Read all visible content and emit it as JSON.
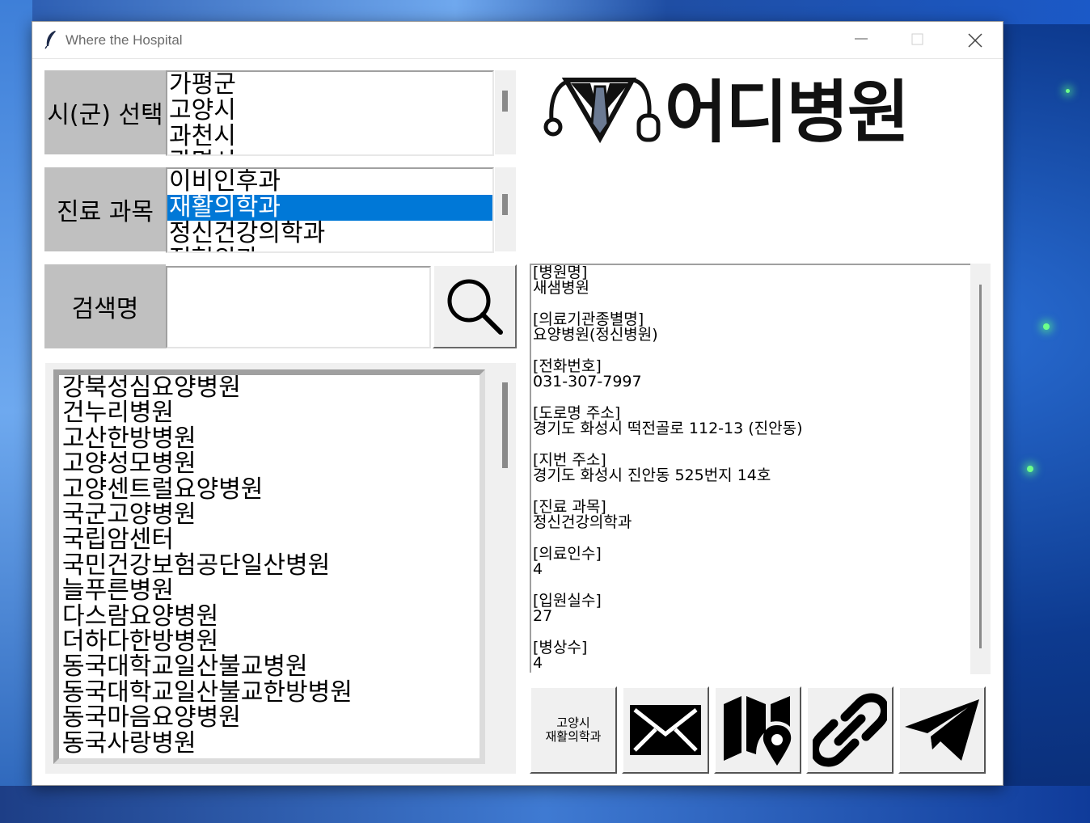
{
  "window": {
    "title": "Where the Hospital"
  },
  "city_panel": {
    "label": "시(군) 선택",
    "items": [
      "가평군",
      "고양시",
      "과천시",
      "광명시"
    ]
  },
  "dept_panel": {
    "label": "진료 과목",
    "items": [
      "이비인후과",
      "재활의학과",
      "정신건강의학과",
      "정형외과"
    ],
    "selected_index": 1
  },
  "search": {
    "label": "검색명",
    "value": ""
  },
  "logo": {
    "text": "어디병원"
  },
  "results": [
    "강북성심요양병원",
    "건누리병원",
    "고산한방병원",
    "고양성모병원",
    "고양센트럴요양병원",
    "국군고양병원",
    "국립암센터",
    "국민건강보험공단일산병원",
    "늘푸른병원",
    "다스람요양병원",
    "더하다한방병원",
    "동국대학교일산불교병원",
    "동국대학교일산불교한방병원",
    "동국마음요양병원",
    "동국사랑병원"
  ],
  "detail": [
    {
      "label": "[병원명]",
      "value": "새샘병원"
    },
    {
      "label": "[의료기관종별명]",
      "value": "요양병원(정신병원)"
    },
    {
      "label": "[전화번호]",
      "value": "031-307-7997"
    },
    {
      "label": "[도로명 주소]",
      "value": "경기도 화성시 떡전골로 112-13 (진안동)"
    },
    {
      "label": "[지번 주소]",
      "value": "경기도 화성시 진안동 525번지 14호"
    },
    {
      "label": "[진료 과목]",
      "value": "정신건강의학과"
    },
    {
      "label": "[의료인수]",
      "value": "4"
    },
    {
      "label": "[입원실수]",
      "value": "27"
    },
    {
      "label": "[병상수]",
      "value": "4"
    }
  ],
  "actions": {
    "region_line1": "고양시",
    "region_line2": "재활의학과",
    "icons": [
      "mail-icon",
      "map-icon",
      "link-icon",
      "telegram-icon"
    ]
  }
}
